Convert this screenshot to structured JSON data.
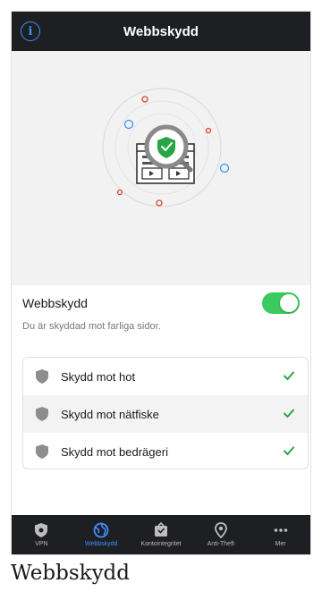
{
  "header": {
    "title": "Webbskydd",
    "info_icon": "info-circle-icon"
  },
  "hero": {
    "illustration": "web-protection-illustration",
    "shield_color": "#27a646",
    "dot_colors": [
      "#e0443a",
      "#3f8fff"
    ]
  },
  "protection": {
    "label": "Webbskydd",
    "enabled": true,
    "toggle_color": "#3cc95f",
    "status_text": "Du är skyddad mot farliga sidor."
  },
  "features": [
    {
      "label": "Skydd mot hot",
      "icon": "shield-icon",
      "checked": true
    },
    {
      "label": "Skydd mot nätfiske",
      "icon": "shield-icon",
      "checked": true
    },
    {
      "label": "Skydd mot bedrägeri",
      "icon": "shield-icon",
      "checked": true
    }
  ],
  "tabbar": {
    "tabs": [
      {
        "label": "VPN",
        "icon": "vpn-shield-icon",
        "active": false
      },
      {
        "label": "Webbskydd",
        "icon": "globe-icon",
        "active": true
      },
      {
        "label": "Kontointegritet",
        "icon": "account-icon",
        "active": false
      },
      {
        "label": "Anti-Theft",
        "icon": "location-icon",
        "active": false
      },
      {
        "label": "Mer",
        "icon": "more-icon",
        "active": false
      }
    ],
    "active_color": "#3f8fff"
  },
  "caption": "Webbskydd"
}
